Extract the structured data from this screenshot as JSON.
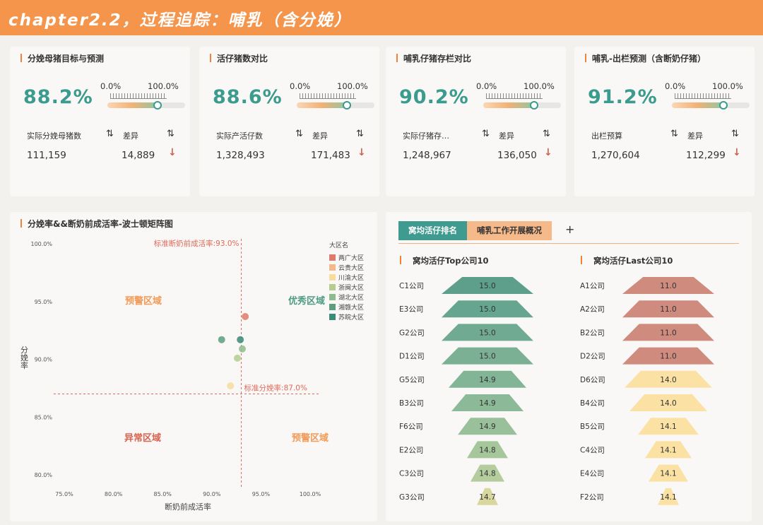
{
  "header": {
    "title": "chapter2.2，过程追踪：哺乳（含分娩）"
  },
  "gauge": {
    "min_label": "0.0%",
    "max_label": "100.0%"
  },
  "kpi_cards": [
    {
      "title": "分娩母猪目标与预测",
      "value": "88.2%",
      "fraction": 0.882,
      "col1_label": "实际分娩母猪数",
      "col1_value": "111,159",
      "col2_label": "差异",
      "col2_value": "14,889"
    },
    {
      "title": "活仔猪数对比",
      "value": "88.6%",
      "fraction": 0.886,
      "col1_label": "实际产活仔数",
      "col1_value": "1,328,493",
      "col2_label": "差异",
      "col2_value": "171,483"
    },
    {
      "title": "哺乳仔猪存栏对比",
      "value": "90.2%",
      "fraction": 0.902,
      "col1_label": "实际仔猪存…",
      "col1_value": "1,248,967",
      "col2_label": "差异",
      "col2_value": "136,050"
    },
    {
      "title": "哺乳-出栏预测（含断奶仔猪）",
      "value": "91.2%",
      "fraction": 0.912,
      "col1_label": "出栏预算",
      "col1_value": "1,270,604",
      "col2_label": "差异",
      "col2_value": "112,299"
    }
  ],
  "icons": {
    "sort": "sort-icon",
    "down_arrow": "arrow-down-icon",
    "add": "plus-icon"
  },
  "chart_data": [
    {
      "type": "scatter",
      "title": "分娩率&&断奶前成活率-波士顿矩阵图",
      "xlabel": "断奶前成活率",
      "ylabel": "分娩率",
      "xlim": [
        75,
        100
      ],
      "ylim": [
        80,
        100
      ],
      "x_ticks": [
        "75.0%",
        "80.0%",
        "85.0%",
        "90.0%",
        "95.0%",
        "100.0%"
      ],
      "y_ticks": [
        "100.0%",
        "95.0%",
        "90.0%",
        "85.0%",
        "80.0%"
      ],
      "legend_title": "大区名",
      "legend_position": "top-right",
      "series": [
        {
          "name": "两广大区",
          "color": "#e07b6a",
          "points": [
            [
              93.4,
              93.7
            ]
          ]
        },
        {
          "name": "云贵大区",
          "color": "#f5b88a",
          "points": []
        },
        {
          "name": "川渝大区",
          "color": "#f7dc9c",
          "points": [
            [
              91.9,
              87.7
            ]
          ]
        },
        {
          "name": "浙闽大区",
          "color": "#b5cc8f",
          "points": [
            [
              92.6,
              90.1
            ]
          ]
        },
        {
          "name": "湖北大区",
          "color": "#8fbc8f",
          "points": [
            [
              93.1,
              90.9
            ]
          ]
        },
        {
          "name": "湘赣大区",
          "color": "#5c9e7e",
          "points": [
            [
              91.0,
              91.7
            ]
          ]
        },
        {
          "name": "苏皖大区",
          "color": "#3a8b77",
          "points": [
            [
              92.9,
              91.7
            ]
          ]
        }
      ],
      "reference_lines": {
        "x": {
          "value": 93.0,
          "label": "标准断奶前成活率:93.0%"
        },
        "y": {
          "value": 87.0,
          "label": "标准分娩率:87.0%"
        }
      },
      "quadrants": {
        "top_left": "预警区域",
        "top_right": "优秀区域",
        "bottom_left": "异常区域",
        "bottom_right": "预警区域"
      },
      "grid": false
    },
    {
      "type": "bar",
      "title": "窝均活仔Top公司10",
      "categories": [
        "C1公司",
        "E3公司",
        "G2公司",
        "D1公司",
        "G5公司",
        "B3公司",
        "F6公司",
        "E2公司",
        "C3公司",
        "G3公司"
      ],
      "values": [
        15.0,
        15.0,
        15.0,
        15.0,
        14.9,
        14.9,
        14.9,
        14.8,
        14.8,
        14.7
      ],
      "labels": [
        "15.0",
        "15.0",
        "15.0",
        "15.0",
        "14.9",
        "14.9",
        "14.9",
        "14.8",
        "14.8",
        "14.7"
      ],
      "colors": [
        "#5e9f8c",
        "#66a590",
        "#70aa93",
        "#7bb095",
        "#82b596",
        "#8cb997",
        "#99c09a",
        "#a6c69c",
        "#b5cc9e",
        "#d8d7a0"
      ]
    },
    {
      "type": "bar",
      "title": "窝均活仔Last公司10",
      "categories": [
        "A1公司",
        "A2公司",
        "B2公司",
        "D2公司",
        "D6公司",
        "B4公司",
        "B5公司",
        "C4公司",
        "E4公司",
        "F2公司"
      ],
      "values": [
        11.0,
        11.0,
        11.0,
        11.0,
        14.0,
        14.0,
        14.1,
        14.1,
        14.1,
        14.1
      ],
      "labels": [
        "11.0",
        "11.0",
        "11.0",
        "11.0",
        "14.0",
        "14.0",
        "14.1",
        "14.1",
        "14.1",
        "14.1"
      ],
      "colors": [
        "#cf8b7e",
        "#cf8b7e",
        "#cf8b7e",
        "#cf8b7e",
        "#fbe2a4",
        "#fbe2a4",
        "#fbe2a4",
        "#fbe2a4",
        "#fbe2a4",
        "#fbe2a4"
      ]
    }
  ],
  "tabs": [
    {
      "label": "窝均活仔排名",
      "active": true
    },
    {
      "label": "哺乳工作开展概况",
      "active": false
    }
  ]
}
